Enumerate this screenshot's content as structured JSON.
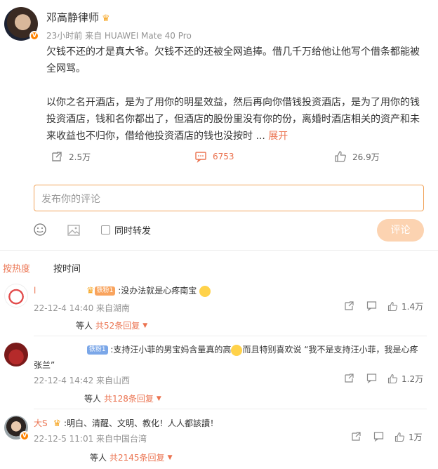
{
  "post": {
    "author": "邓高静律师",
    "meta": "23小时前  来自 HUAWEI Mate 40 Pro",
    "line1": "欠钱不还的才是真大爷。欠钱不还的还被全网追捧。借几千万给他让他写个借条都能被",
    "line2": "全网骂。",
    "line3": "以你之名开酒店，是为了用你的明星效益，然后再向你借钱投资酒店，是为了用你的钱",
    "line4": "投资酒店，钱和名你都出了，但酒店的股份里没有你的份，离婚时酒店相关的资产和未",
    "line5": "来收益也不归你，借给他投资酒店的钱也没按时  ... ",
    "expand": "展开",
    "reposts": "2.5万",
    "comments": "6753",
    "likes": "26.9万"
  },
  "composer": {
    "placeholder": "发布你的评论",
    "forward_label": "同时转发",
    "submit": "评论"
  },
  "tabs": {
    "hot": "按热度",
    "time": "按时间"
  },
  "comments": [
    {
      "name": "l",
      "badge": "铁粉1",
      "text": ":没办法就是心疼南宝",
      "meta": "22-12-4 14:40 来自湖南",
      "likes": "1.4万",
      "reply_prefix": "等人",
      "reply_count": "共52条回复"
    },
    {
      "name": "",
      "badge": "铁粉1",
      "text": ":支持汪小菲的男宝妈含量真的高",
      "text2": "而且特别喜欢说 “我不是支持汪小菲，我是心疼",
      "text3": "张兰”",
      "meta": "22-12-4 14:42 来自山西",
      "likes": "1.2万",
      "reply_prefix": "等人",
      "reply_count": "共128条回复"
    },
    {
      "name": "大S",
      "text": ":明白、清醒、文明、教化！人人都該讀！",
      "meta": "22-12-5 11:01 来自中国台湾",
      "likes": "1万",
      "reply_prefix": "等人",
      "reply_count": "共2145条回复"
    }
  ]
}
